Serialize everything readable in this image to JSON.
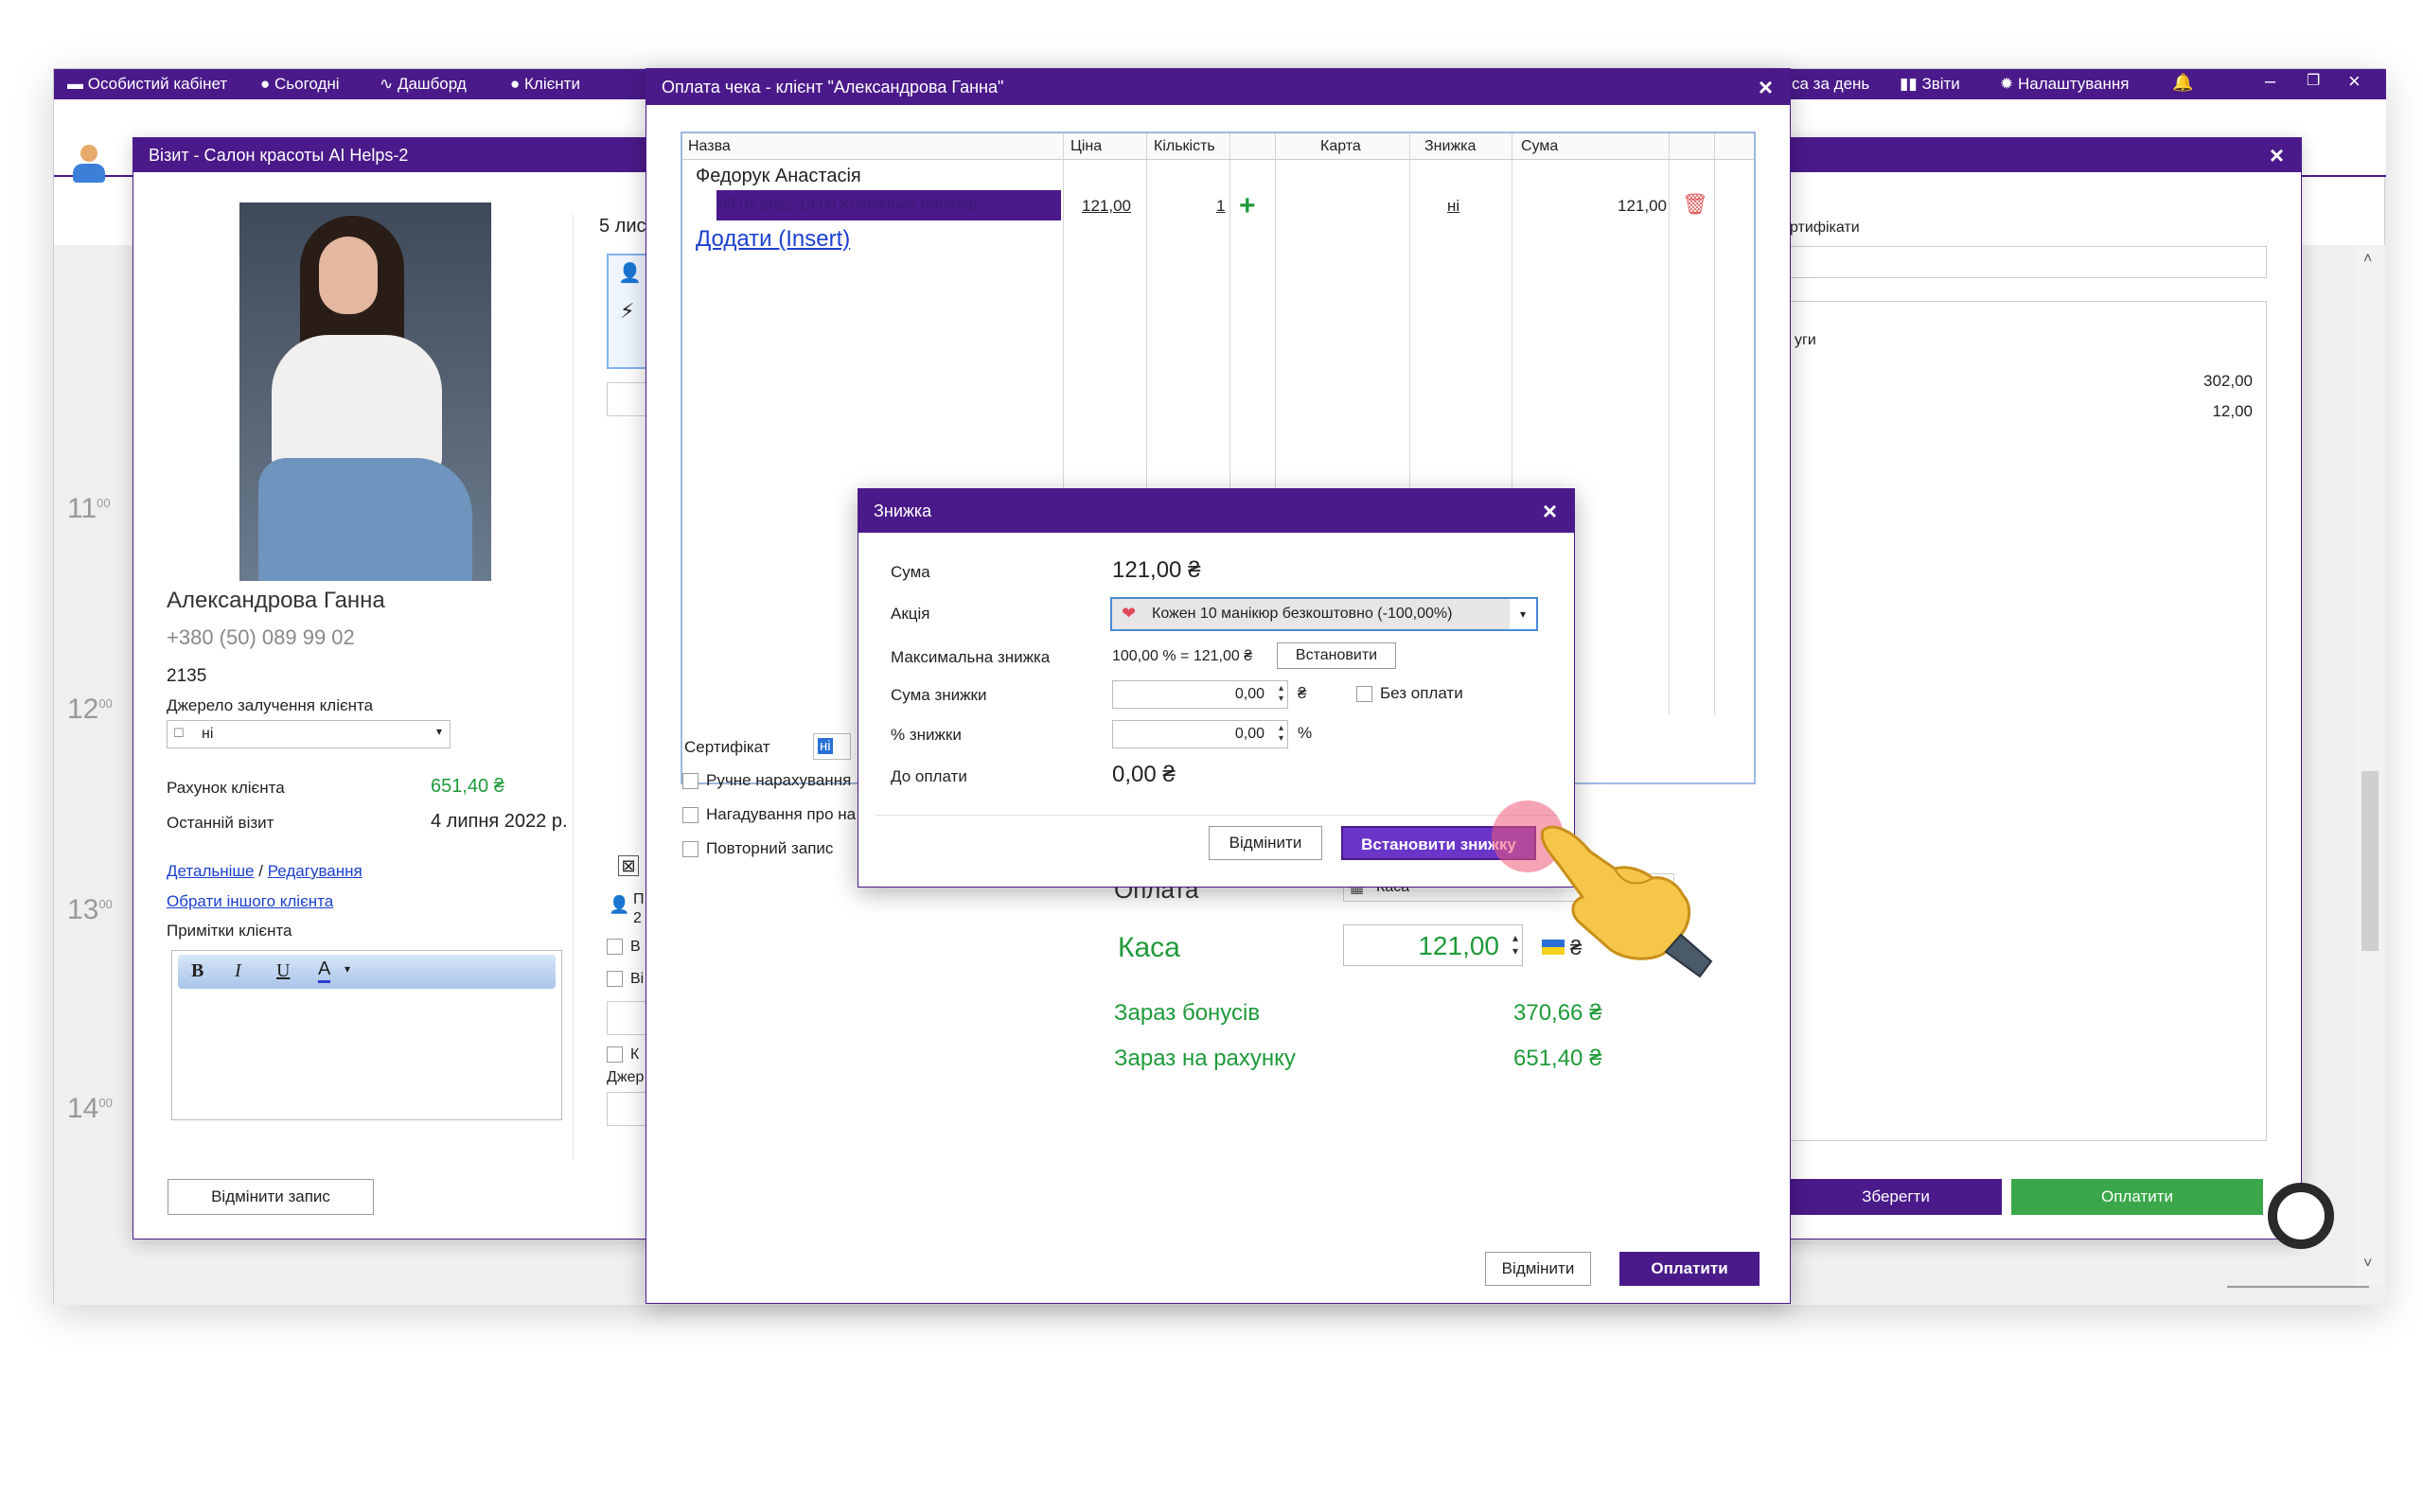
{
  "app_bar": {
    "cabinet": "Особистий кабінет",
    "today": "Сьогодні",
    "dashboard": "Дашборд",
    "clients": "Клієнти",
    "cash_day": "са за день",
    "reports": "Звіти",
    "settings": "Налаштування"
  },
  "calendar": {
    "hours": [
      "11",
      "12",
      "13",
      "14"
    ],
    "minutes": "00"
  },
  "visit_dialog": {
    "title": "Візит - Салон красоты AI Helps-2",
    "client_name": "Александрова Ганна",
    "client_phone": "+380 (50) 089 99 02",
    "client_code": "2135",
    "source_label": "Джерело залучення клієнта",
    "source_value": "ні",
    "account_label": "Рахунок клієнта",
    "account_value": "651,40 ₴",
    "last_visit_label": "Останній візит",
    "last_visit_value": "4 липня 2022 р.",
    "details_link": "Детальніше",
    "separator": "/",
    "edit_link": "Редагування",
    "choose_other_link": "Обрати іншого клієнта",
    "notes_label": "Примітки клієнта",
    "cancel_record": "Відмінити запис",
    "lessons_partial": "5 лис",
    "partial_letters": [
      "П",
      "2",
      "В",
      "Ві",
      "К",
      "Джер"
    ],
    "certificates_partial": "ртифікати",
    "services_partial": "уги",
    "total_1": "302,00",
    "total_2": "12,00",
    "save": "Зберегти",
    "pay": "Оплатити"
  },
  "payment_dialog": {
    "title": "Оплата чека - клієнт \"Александрова Ганна\"",
    "columns": [
      "Назва",
      "Ціна",
      "Кількість",
      "",
      "Карта",
      "Знижка",
      "Сума",
      ""
    ],
    "master": "Федорук Анастасія",
    "row": {
      "name": "05.07.2022 13:00 Класичний манікюр",
      "price": "121,00",
      "qty": "1",
      "discount": "ні",
      "sum": "121,00"
    },
    "add_link": "Додати (Insert)",
    "certificate_label": "Сертифікат",
    "certificate_value": "ні",
    "manual_accrual": "Ручне нарахування",
    "reminder": "Нагадування про на",
    "repeat": "Повторний запис",
    "payment_label": "Оплата",
    "payment_method": "Каса",
    "cash_label": "Каса",
    "cash_value": "121,00",
    "currency": "₴",
    "bonuses_label": "Зараз бонусів",
    "bonuses_value": "370,66 ₴",
    "account_label": "Зараз на рахунку",
    "account_value": "651,40 ₴",
    "cancel": "Відмінити",
    "pay": "Оплатити"
  },
  "discount_dialog": {
    "title": "Знижка",
    "sum_label": "Сума",
    "sum_value": "121,00 ₴",
    "promo_label": "Акція",
    "promo_value": "Кожен 10 манікюр безкоштовно (-100,00%)",
    "max_label": "Максимальна знижка",
    "max_value": "100,00 % = 121,00 ₴",
    "set_button": "Встановити",
    "discount_sum_label": "Сума знижки",
    "discount_sum_value": "0,00",
    "currency": "₴",
    "no_payment": "Без оплати",
    "percent_label": "% знижки",
    "percent_value": "0,00",
    "percent_sign": "%",
    "to_pay_label": "До оплати",
    "to_pay_value": "0,00 ₴",
    "cancel": "Відмінити",
    "apply": "Встановити знижку"
  },
  "colors": {
    "brand": "#4a1a8a",
    "green": "#1f9a3a",
    "pay_green": "#3aa84a",
    "selection": "#4a1a8a"
  }
}
